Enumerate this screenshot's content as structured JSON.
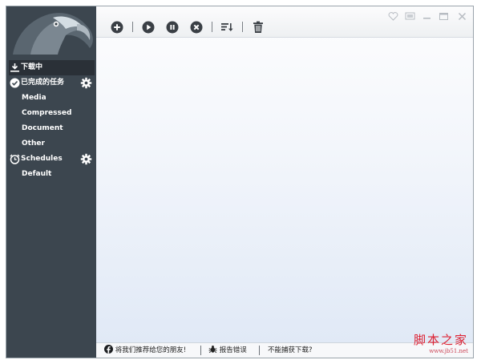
{
  "sidebar": {
    "items": [
      {
        "label": "下载中",
        "icon": "download-icon"
      },
      {
        "label": "已完成的任务",
        "icon": "check-circle-icon",
        "gear": "gear-icon"
      },
      {
        "label": "Media"
      },
      {
        "label": "Compressed"
      },
      {
        "label": "Document"
      },
      {
        "label": "Other"
      },
      {
        "label": "Schedules",
        "icon": "alarm-clock-icon",
        "gear": "gear-icon"
      },
      {
        "label": "Default"
      }
    ]
  },
  "toolbar": {
    "buttons": [
      "add-icon",
      "play-icon",
      "pause-icon",
      "cancel-icon",
      "sort-icon",
      "trash-icon"
    ]
  },
  "window_controls": [
    "heart-icon",
    "screen-icon",
    "minimize-icon",
    "maximize-icon",
    "close-icon"
  ],
  "statusbar": {
    "recommend": "将我们推荐给您的朋友!",
    "report": "报告错误",
    "cannot_capture": "不能捕获下载?"
  },
  "watermark": {
    "text": "脚本之家",
    "url": "www.jb51.net"
  },
  "colors": {
    "sidebar": "#3c464f",
    "sidebar_active": "#2a3037",
    "accent_watermark": "#dd2233"
  }
}
